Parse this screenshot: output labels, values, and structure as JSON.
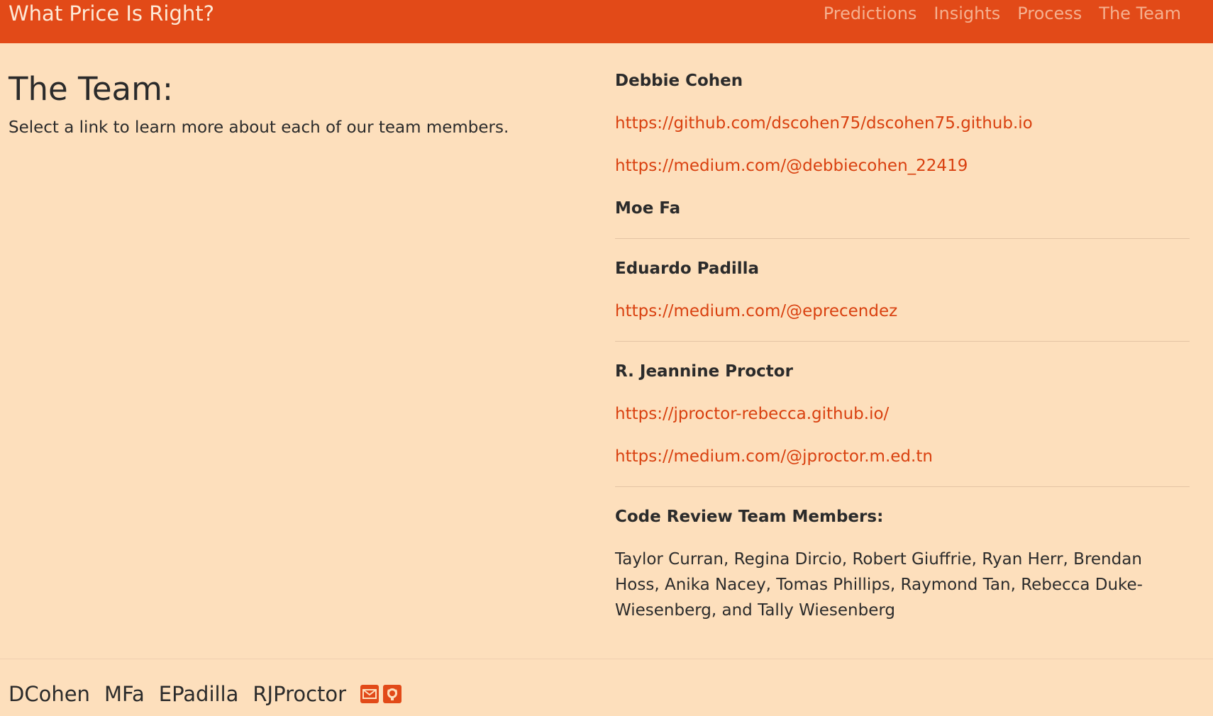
{
  "navbar": {
    "brand": "What Price Is Right?",
    "links": [
      "Predictions",
      "Insights",
      "Process",
      "The Team"
    ]
  },
  "intro": {
    "title": "The Team:",
    "subtitle": "Select a link to learn more about each of our team members."
  },
  "members": [
    {
      "name": "Debbie Cohen",
      "links": [
        "https://github.com/dscohen75/dscohen75.github.io",
        "https://medium.com/@debbiecohen_22419"
      ]
    },
    {
      "name": "Moe Fa",
      "links": []
    },
    {
      "name": "Eduardo Padilla",
      "links": [
        "https://medium.com/@eprecendez"
      ]
    },
    {
      "name": "R. Jeannine Proctor",
      "links": [
        "https://jproctor-rebecca.github.io/",
        "https://medium.com/@jproctor.m.ed.tn"
      ]
    }
  ],
  "code_review": {
    "heading": "Code Review Team Members:",
    "names": "Taylor Curran, Regina Dircio, Robert Giuffrie, Ryan Herr, Brendan Hoss, Anika Nacey, Tomas Phillips, Raymond Tan, Rebecca Duke-Wiesenberg, and Tally Wiesenberg"
  },
  "footer": {
    "links": [
      "DCohen",
      "MFa",
      "EPadilla",
      "RJProctor"
    ],
    "icons": [
      "envelope-icon",
      "github-icon"
    ]
  },
  "colors": {
    "navbar_bg": "#e24a18",
    "page_bg": "#fddfbc",
    "link": "#d9400f"
  }
}
